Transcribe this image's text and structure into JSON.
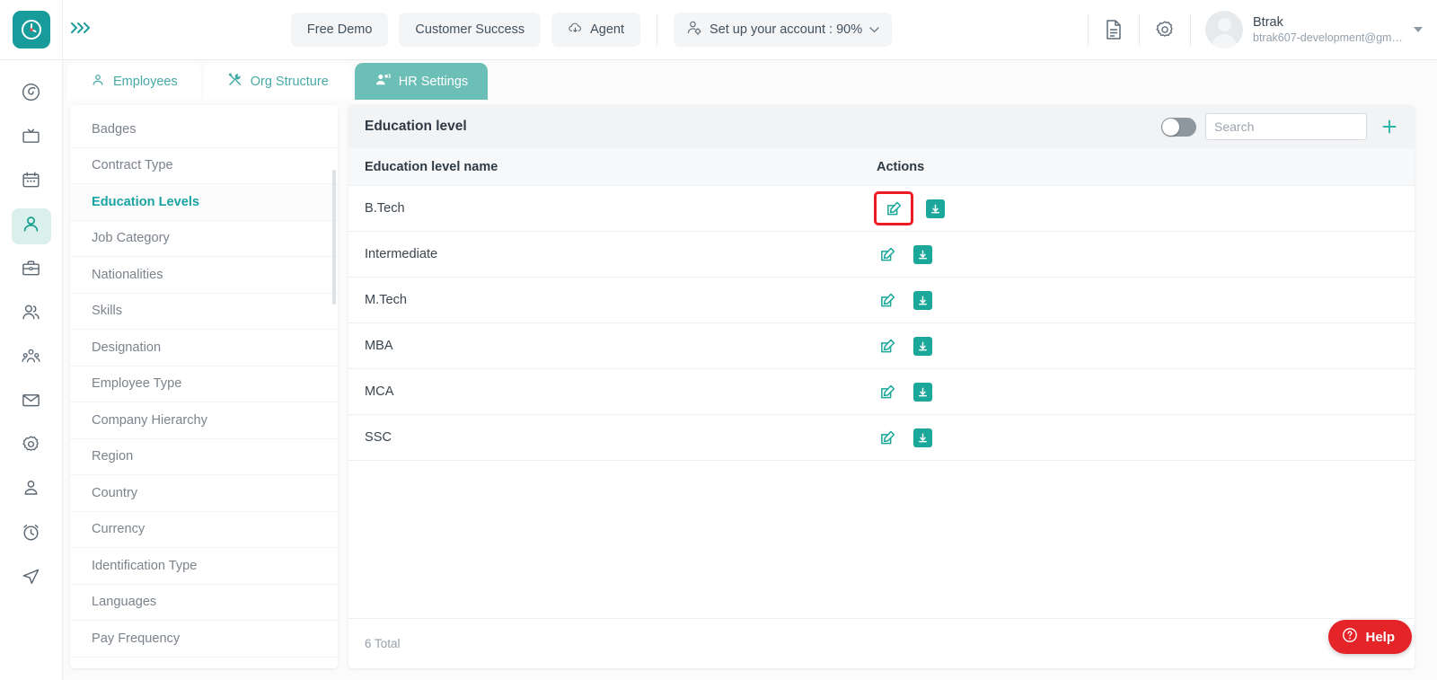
{
  "topbar": {
    "logo_icon": "clock-logo-icon",
    "expand_icon": "expand-chevrons-icon",
    "expand_label": "»»",
    "buttons": [
      {
        "label": "Free Demo",
        "icon": null
      },
      {
        "label": "Customer Success",
        "icon": null
      },
      {
        "label": "Agent",
        "icon": "cloud-icon"
      }
    ],
    "account_setup": {
      "label": "Set up your account : 90%",
      "icon": "user-gear-icon",
      "percent": "90%"
    },
    "doc_icon": "document-icon",
    "gear_icon": "gear-icon",
    "user": {
      "name": "Btrak",
      "email": "btrak607-development@gm…",
      "avatar_icon": "avatar-placeholder-icon",
      "caret_icon": "chevron-down-icon"
    }
  },
  "rail": {
    "items": [
      {
        "name": "dashboard-icon",
        "active": false
      },
      {
        "name": "tv-board-icon",
        "active": false
      },
      {
        "name": "calendar-icon",
        "active": false
      },
      {
        "name": "person-icon",
        "active": true
      },
      {
        "name": "briefcase-icon",
        "active": false
      },
      {
        "name": "people-icon",
        "active": false
      },
      {
        "name": "org-group-icon",
        "active": false
      },
      {
        "name": "mail-icon",
        "active": false
      },
      {
        "name": "settings-gear-icon",
        "active": false
      },
      {
        "name": "user-profile-icon",
        "active": false
      },
      {
        "name": "alarm-clock-icon",
        "active": false
      },
      {
        "name": "send-icon",
        "active": false
      }
    ]
  },
  "tabs": [
    {
      "label": "Employees",
      "icon": "person-icon",
      "active": false
    },
    {
      "label": "Org Structure",
      "icon": "tools-icon",
      "active": false
    },
    {
      "label": "HR Settings",
      "icon": "users-gear-icon",
      "active": true
    }
  ],
  "settings_sidebar": {
    "items": [
      {
        "label": "Badges",
        "active": false
      },
      {
        "label": "Contract Type",
        "active": false
      },
      {
        "label": "Education Levels",
        "active": true
      },
      {
        "label": "Job Category",
        "active": false
      },
      {
        "label": "Nationalities",
        "active": false
      },
      {
        "label": "Skills",
        "active": false
      },
      {
        "label": "Designation",
        "active": false
      },
      {
        "label": "Employee Type",
        "active": false
      },
      {
        "label": "Company Hierarchy",
        "active": false
      },
      {
        "label": "Region",
        "active": false
      },
      {
        "label": "Country",
        "active": false
      },
      {
        "label": "Currency",
        "active": false
      },
      {
        "label": "Identification Type",
        "active": false
      },
      {
        "label": "Languages",
        "active": false
      },
      {
        "label": "Pay Frequency",
        "active": false
      }
    ]
  },
  "main": {
    "title": "Education level",
    "toggle": {
      "name": "archive-toggle",
      "state": "off"
    },
    "search": {
      "value": "",
      "placeholder": "Search"
    },
    "add_button": {
      "icon": "plus-icon",
      "label": "+"
    },
    "table": {
      "columns": [
        "Education level name",
        "Actions"
      ],
      "rows": [
        {
          "name": "B.Tech",
          "edit_icon": "edit-pencil-icon",
          "archive_icon": "archive-down-icon",
          "highlighted": true
        },
        {
          "name": "Intermediate",
          "edit_icon": "edit-pencil-icon",
          "archive_icon": "archive-down-icon",
          "highlighted": false
        },
        {
          "name": "M.Tech",
          "edit_icon": "edit-pencil-icon",
          "archive_icon": "archive-down-icon",
          "highlighted": false
        },
        {
          "name": "MBA",
          "edit_icon": "edit-pencil-icon",
          "archive_icon": "archive-down-icon",
          "highlighted": false
        },
        {
          "name": "MCA",
          "edit_icon": "edit-pencil-icon",
          "archive_icon": "archive-down-icon",
          "highlighted": false
        },
        {
          "name": "SSC",
          "edit_icon": "edit-pencil-icon",
          "archive_icon": "archive-down-icon",
          "highlighted": false
        }
      ]
    },
    "footer_total": "6 Total"
  },
  "help": {
    "label": "Help",
    "icon": "question-circle-icon"
  },
  "colors": {
    "brand_teal": "#179b9b",
    "accent_teal": "#1ba79a",
    "tab_active": "#6cbfb7",
    "highlight_red": "#ec1c24",
    "help_red": "#e42428",
    "page_bg": "#fbfbfc"
  }
}
